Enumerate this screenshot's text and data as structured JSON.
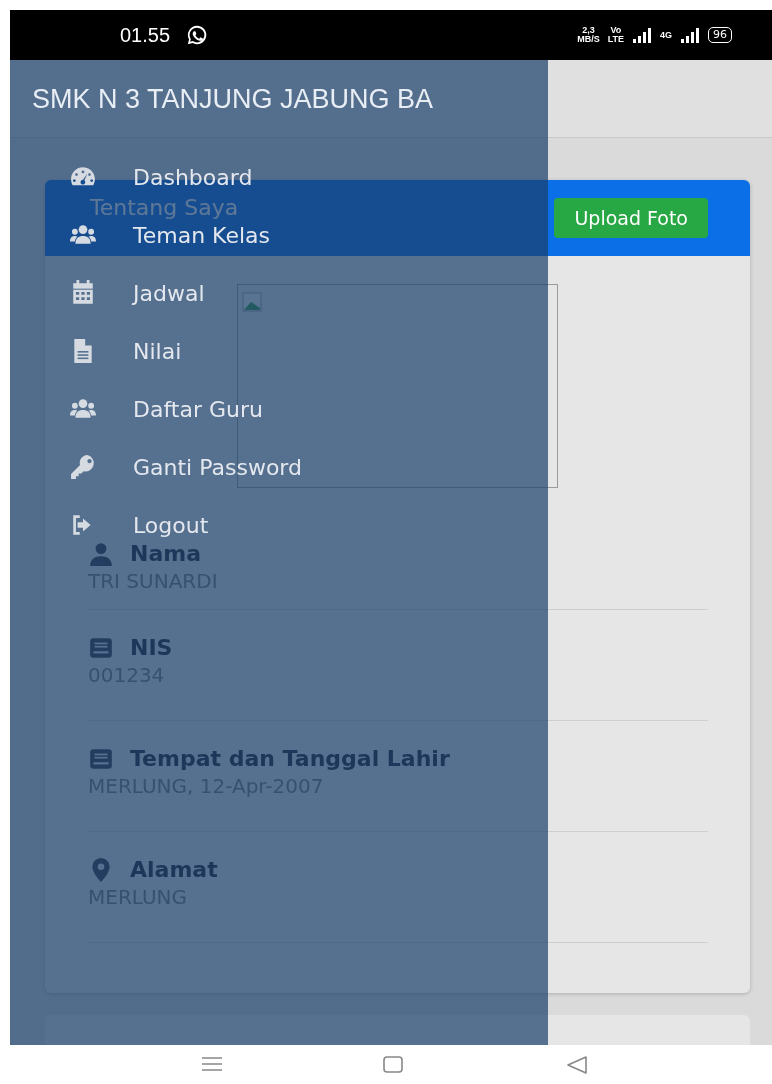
{
  "status_bar": {
    "time": "01.55",
    "speed": "2,3",
    "speed_unit": "MB/S",
    "volte_top": "Vo",
    "volte_bottom": "LTE",
    "network": "4G",
    "battery": "96"
  },
  "sidebar": {
    "title": "SMK N 3 TANJUNG JABUNG BA",
    "items": [
      {
        "kind": "gauge",
        "label": "Dashboard"
      },
      {
        "kind": "users",
        "label": "Teman Kelas"
      },
      {
        "kind": "calendar",
        "label": "Jadwal"
      },
      {
        "kind": "file",
        "label": "Nilai"
      },
      {
        "kind": "users",
        "label": "Daftar Guru"
      },
      {
        "kind": "key",
        "label": "Ganti Password"
      },
      {
        "kind": "logout",
        "label": "Logout"
      }
    ]
  },
  "profile_card": {
    "title": "Tentang Saya",
    "button": "Upload Foto",
    "fields": [
      {
        "kind": "user",
        "label": "Nama",
        "value": "TRI SUNARDI"
      },
      {
        "kind": "book",
        "label": "NIS",
        "value": "001234"
      },
      {
        "kind": "book",
        "label": "Tempat dan Tanggal Lahir",
        "value": "MERLUNG, 12-Apr-2007"
      },
      {
        "kind": "pin",
        "label": "Alamat",
        "value": "MERLUNG"
      }
    ]
  }
}
